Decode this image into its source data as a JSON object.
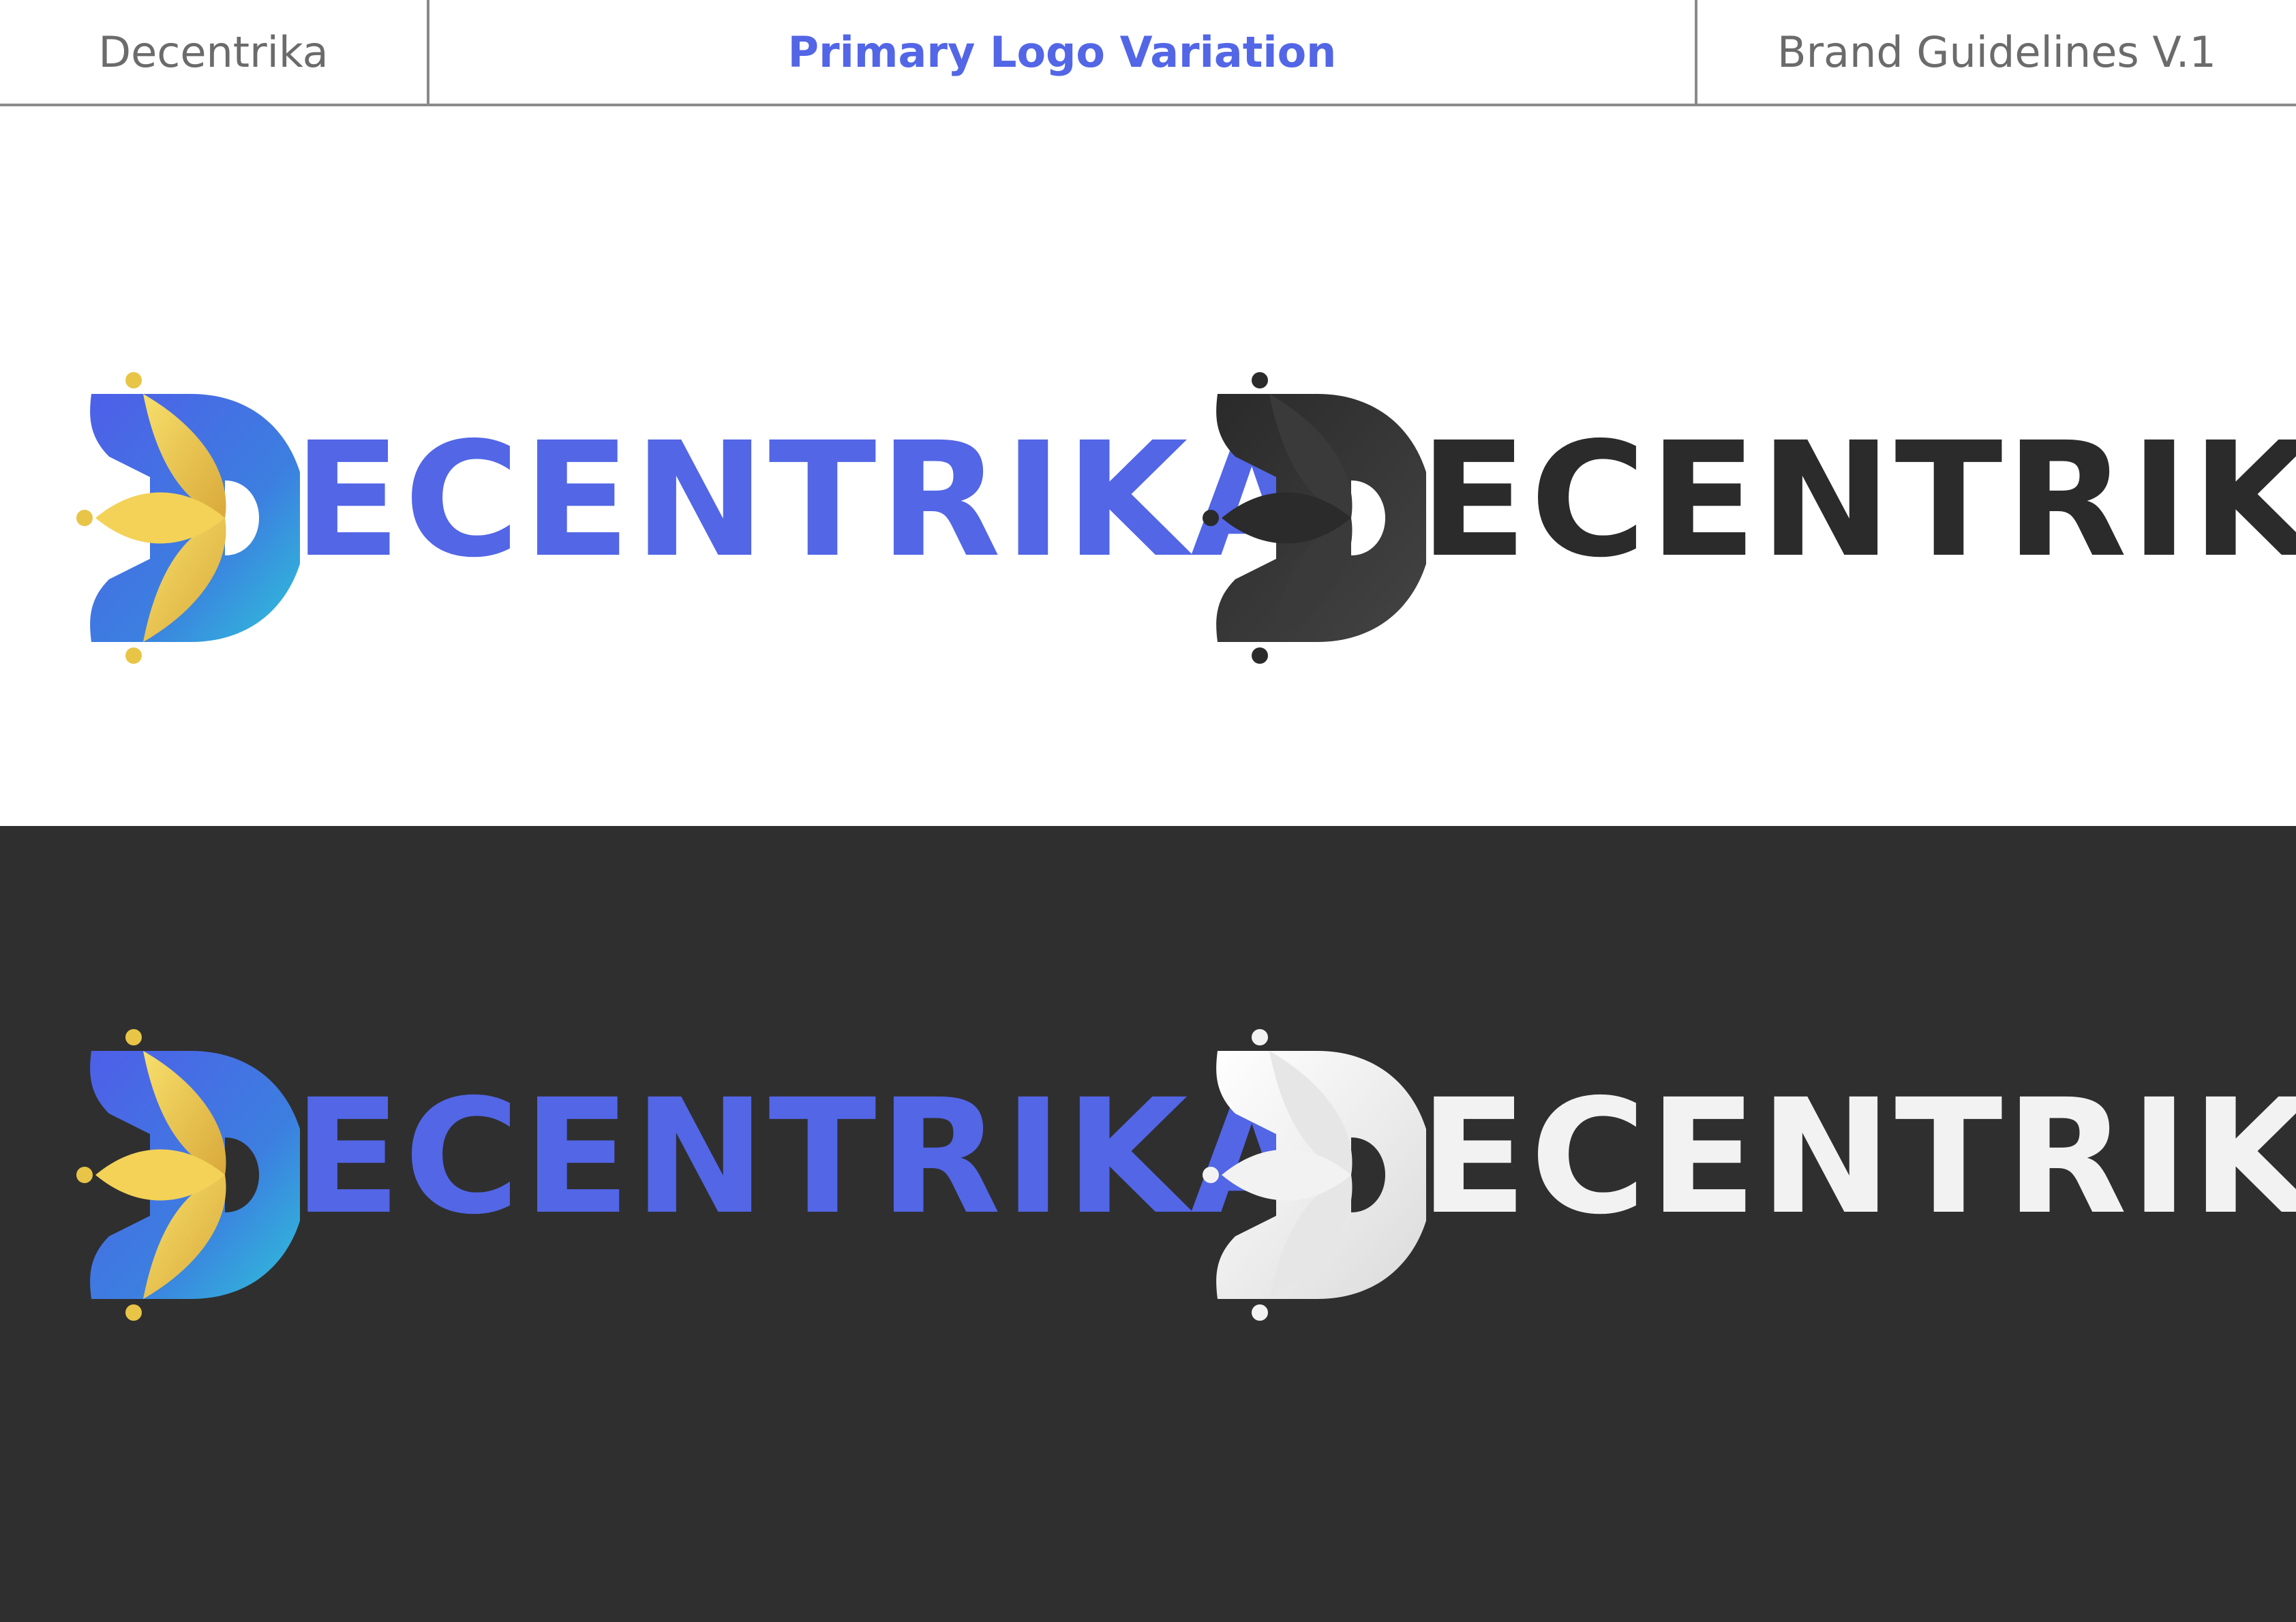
{
  "header": {
    "brand": "Decentrika",
    "title": "Primary Logo Variation",
    "version": "Brand Guidelines V.1"
  },
  "colors": {
    "accent": "#5266E6",
    "dark": "#2F2F2F",
    "gold": "#E8C547",
    "cyan": "#2EC4D9",
    "light": "#F2F2F2"
  },
  "logos": [
    {
      "variant": "color-on-light",
      "wordmark": "ECENTRIKA",
      "text_color": "#5266E6"
    },
    {
      "variant": "mono-dark-on-light",
      "wordmark": "ECENTRIKA",
      "text_color": "#2B2B2B"
    },
    {
      "variant": "color-on-dark",
      "wordmark": "ECENTRIKA",
      "text_color": "#5266E6"
    },
    {
      "variant": "mono-white-on-dark",
      "wordmark": "ECENTRIKA",
      "text_color": "#F2F2F2"
    }
  ]
}
